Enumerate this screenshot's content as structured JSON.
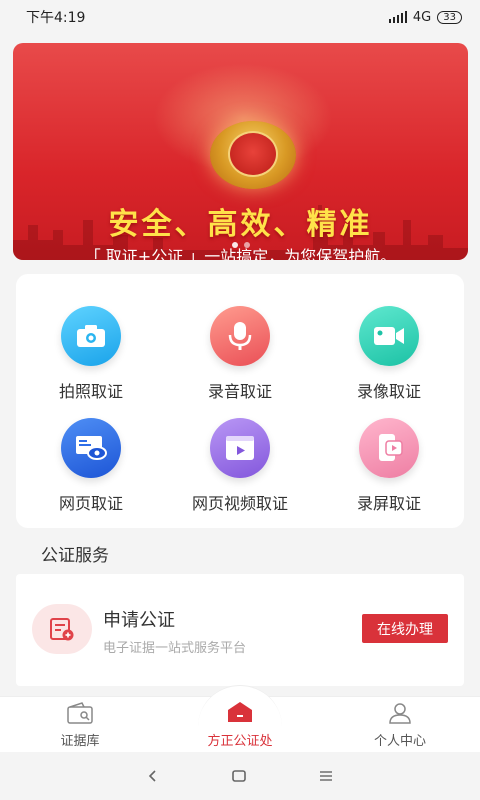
{
  "status_bar": {
    "time": "下午4:19",
    "network": "4G",
    "battery": "33"
  },
  "banner": {
    "headline": "安全、高效、精准",
    "subline": "「 取证+公证 」一站搞定，为您保驾护航。"
  },
  "grid": [
    {
      "label": "拍照取证",
      "icon": "camera-icon",
      "color": "#2ab5f0"
    },
    {
      "label": "录音取证",
      "icon": "microphone-icon",
      "color": "#f06a6a"
    },
    {
      "label": "录像取证",
      "icon": "video-camera-icon",
      "color": "#2fd3b8"
    },
    {
      "label": "网页取证",
      "icon": "webpage-eye-icon",
      "color": "#2e6ee8"
    },
    {
      "label": "网页视频取证",
      "icon": "web-video-icon",
      "color": "#9b6ee6"
    },
    {
      "label": "录屏取证",
      "icon": "screen-record-icon",
      "color": "#f28fb0"
    }
  ],
  "section_title": "公证服务",
  "service": {
    "title": "申请公证",
    "subtitle": "电子证据一站式服务平台",
    "button": "在线办理"
  },
  "bottom_nav": {
    "left": "证据库",
    "center": "方正公证处",
    "right": "个人中心"
  },
  "colors": {
    "accent": "#d9323a",
    "banner_red": "#d9252a",
    "headline_yellow": "#ffe24a"
  }
}
